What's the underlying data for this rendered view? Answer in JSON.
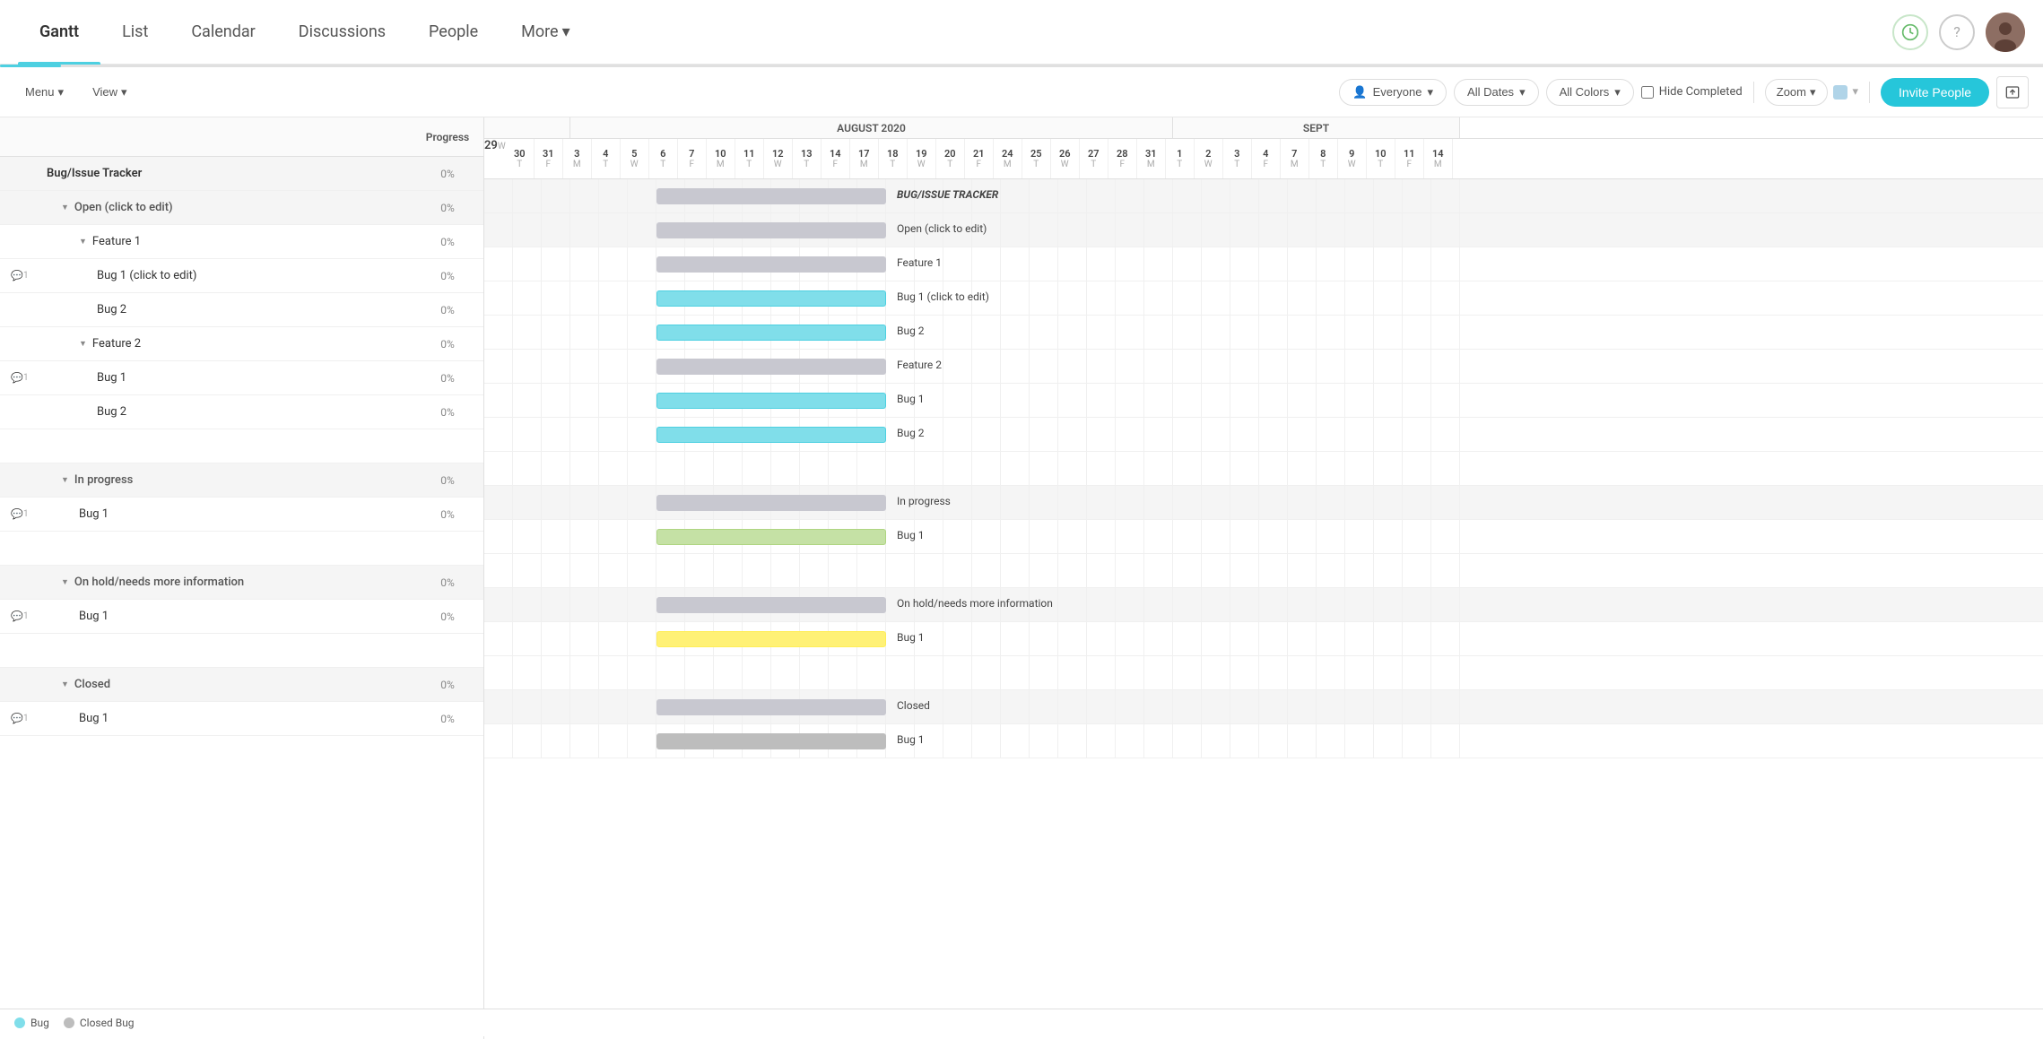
{
  "nav": {
    "items": [
      {
        "label": "Gantt",
        "active": true
      },
      {
        "label": "List",
        "active": false
      },
      {
        "label": "Calendar",
        "active": false
      },
      {
        "label": "Discussions",
        "active": false
      },
      {
        "label": "People",
        "active": false
      },
      {
        "label": "More",
        "active": false,
        "arrow": true
      }
    ]
  },
  "toolbar": {
    "menu_label": "Menu",
    "view_label": "View",
    "everyone_label": "Everyone",
    "all_dates_label": "All Dates",
    "all_colors_label": "All Colors",
    "hide_completed_label": "Hide Completed",
    "zoom_label": "Zoom",
    "invite_label": "Invite People"
  },
  "gantt": {
    "months": [
      {
        "label": "AUGUST 2020",
        "days": 31
      },
      {
        "label": "SEPT",
        "days": 14
      }
    ],
    "days_july_end": [
      {
        "num": "29",
        "letter": "W"
      },
      {
        "num": "30",
        "letter": "T"
      },
      {
        "num": "31",
        "letter": "F"
      }
    ],
    "days_august": [
      {
        "num": "3",
        "letter": "M"
      },
      {
        "num": "4",
        "letter": "T"
      },
      {
        "num": "5",
        "letter": "W"
      },
      {
        "num": "6",
        "letter": "T"
      },
      {
        "num": "7",
        "letter": "F"
      },
      {
        "num": "10",
        "letter": "M"
      },
      {
        "num": "11",
        "letter": "T"
      },
      {
        "num": "12",
        "letter": "W"
      },
      {
        "num": "13",
        "letter": "T"
      },
      {
        "num": "14",
        "letter": "F"
      },
      {
        "num": "17",
        "letter": "M"
      },
      {
        "num": "18",
        "letter": "T"
      },
      {
        "num": "19",
        "letter": "W"
      },
      {
        "num": "20",
        "letter": "T"
      },
      {
        "num": "21",
        "letter": "F"
      },
      {
        "num": "24",
        "letter": "M"
      },
      {
        "num": "25",
        "letter": "T"
      },
      {
        "num": "26",
        "letter": "W"
      },
      {
        "num": "27",
        "letter": "T"
      },
      {
        "num": "28",
        "letter": "F"
      },
      {
        "num": "31",
        "letter": "M"
      }
    ],
    "days_sept": [
      {
        "num": "1",
        "letter": "T"
      },
      {
        "num": "2",
        "letter": "W"
      },
      {
        "num": "3",
        "letter": "T"
      },
      {
        "num": "4",
        "letter": "F"
      },
      {
        "num": "7",
        "letter": "M"
      },
      {
        "num": "8",
        "letter": "T"
      },
      {
        "num": "9",
        "letter": "W"
      },
      {
        "num": "10",
        "letter": "T"
      },
      {
        "num": "11",
        "letter": "F"
      },
      {
        "num": "14",
        "letter": "M"
      }
    ]
  },
  "rows": [
    {
      "id": "bug-tracker",
      "level": 0,
      "label": "Bug/Issue Tracker",
      "progress": "0%",
      "type": "section",
      "comment": false
    },
    {
      "id": "open",
      "level": 1,
      "label": "Open (click to edit)",
      "progress": "0%",
      "type": "group",
      "comment": false,
      "collapsible": true
    },
    {
      "id": "feature1",
      "level": 2,
      "label": "Feature 1",
      "progress": "0%",
      "type": "group",
      "comment": false,
      "collapsible": true
    },
    {
      "id": "bug1-f1",
      "level": 3,
      "label": "Bug 1 (click to edit)",
      "progress": "0%",
      "type": "task",
      "comment": true,
      "color": "cyan"
    },
    {
      "id": "bug2-f1",
      "level": 3,
      "label": "Bug 2",
      "progress": "0%",
      "type": "task",
      "comment": false,
      "color": "cyan"
    },
    {
      "id": "feature2",
      "level": 2,
      "label": "Feature 2",
      "progress": "0%",
      "type": "group",
      "comment": false,
      "collapsible": true
    },
    {
      "id": "bug1-f2",
      "level": 3,
      "label": "Bug 1",
      "progress": "0%",
      "type": "task",
      "comment": true,
      "color": "cyan"
    },
    {
      "id": "bug2-f2",
      "level": 3,
      "label": "Bug 2",
      "progress": "0%",
      "type": "task",
      "comment": false,
      "color": "cyan"
    },
    {
      "id": "spacer1",
      "type": "spacer"
    },
    {
      "id": "in-progress",
      "level": 1,
      "label": "In progress",
      "progress": "0%",
      "type": "group",
      "comment": false,
      "collapsible": true
    },
    {
      "id": "bug1-ip",
      "level": 2,
      "label": "Bug 1",
      "progress": "0%",
      "type": "task",
      "comment": true,
      "color": "green"
    },
    {
      "id": "spacer2",
      "type": "spacer"
    },
    {
      "id": "on-hold",
      "level": 1,
      "label": "On hold/needs more information",
      "progress": "0%",
      "type": "group",
      "comment": false,
      "collapsible": true
    },
    {
      "id": "bug1-oh",
      "level": 2,
      "label": "Bug 1",
      "progress": "0%",
      "type": "task",
      "comment": true,
      "color": "yellow"
    },
    {
      "id": "spacer3",
      "type": "spacer"
    },
    {
      "id": "closed",
      "level": 1,
      "label": "Closed",
      "progress": "0%",
      "type": "group",
      "comment": false,
      "collapsible": true
    },
    {
      "id": "bug1-cl",
      "level": 2,
      "label": "Bug 1",
      "progress": "0%",
      "type": "task",
      "comment": true,
      "color": "silver"
    }
  ],
  "legend": {
    "items": [
      {
        "label": "Bug",
        "color": "#80deea"
      },
      {
        "label": "Closed Bug",
        "color": "#bdbdbd"
      }
    ]
  }
}
